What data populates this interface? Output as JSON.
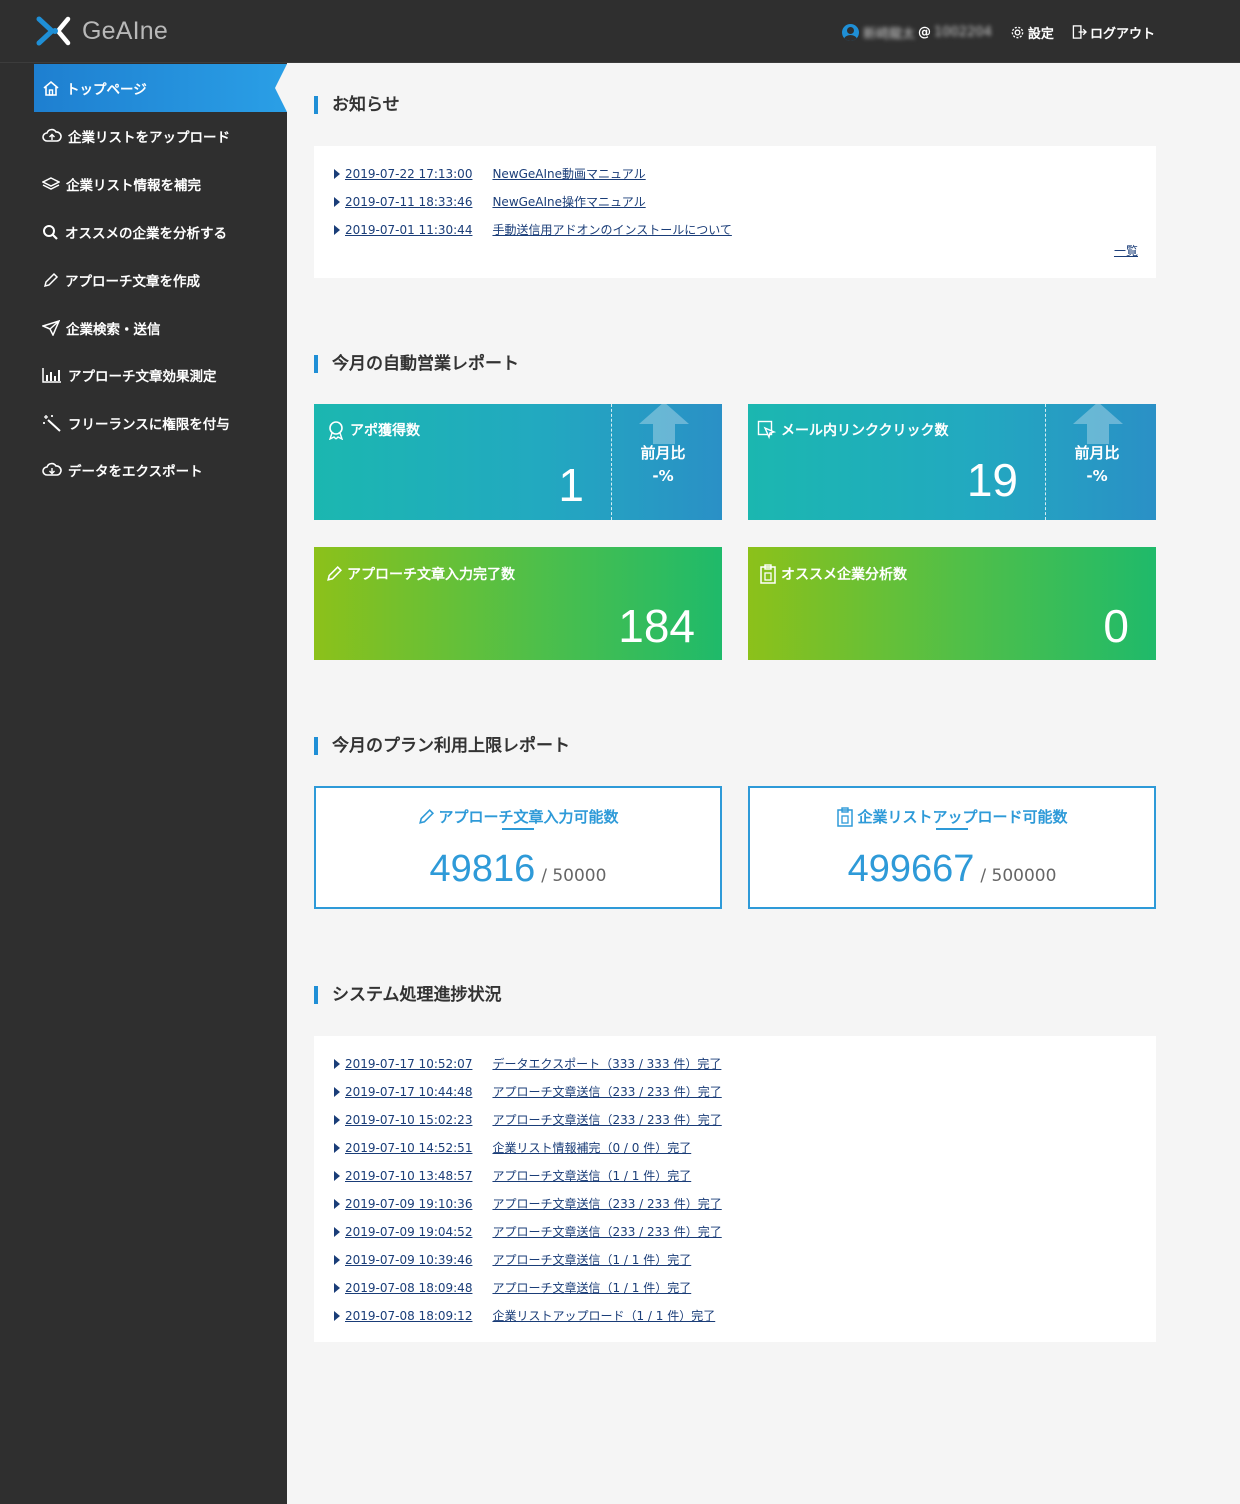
{
  "app": {
    "name": "GeAIne"
  },
  "header": {
    "user_name": "新崎龍太",
    "user_at": "@",
    "user_id": "1002204",
    "settings_label": "設定",
    "logout_label": "ログアウト"
  },
  "sidebar": {
    "items": [
      {
        "label": "トップページ",
        "icon": "home-icon"
      },
      {
        "label": "企業リストをアップロード",
        "icon": "cloud-upload-icon"
      },
      {
        "label": "企業リスト情報を補完",
        "icon": "layers-icon"
      },
      {
        "label": "オススメの企業を分析する",
        "icon": "search-icon"
      },
      {
        "label": "アプローチ文章を作成",
        "icon": "pencil-icon"
      },
      {
        "label": "企業検索・送信",
        "icon": "paper-plane-icon"
      },
      {
        "label": "アプローチ文章効果測定",
        "icon": "bar-chart-icon"
      },
      {
        "label": "フリーランスに権限を付与",
        "icon": "magic-wand-icon"
      },
      {
        "label": "データをエクスポート",
        "icon": "cloud-export-icon"
      }
    ]
  },
  "notices": {
    "title": "お知らせ",
    "items": [
      {
        "datetime": "2019-07-22 17:13:00",
        "text": "NewGeAIne動画マニュアル"
      },
      {
        "datetime": "2019-07-11 18:33:46",
        "text": "NewGeAIne操作マニュアル"
      },
      {
        "datetime": "2019-07-01 11:30:44",
        "text": "手動送信用アドオンのインストールについて"
      }
    ],
    "more_label": "一覧"
  },
  "monthly_report": {
    "title": "今月の自動営業レポート",
    "appointments": {
      "label": "アポ獲得数",
      "value": "1",
      "cmp_label": "前月比",
      "cmp_value": "-%"
    },
    "link_clicks": {
      "label": "メール内リンククリック数",
      "value": "19",
      "cmp_label": "前月比",
      "cmp_value": "-%"
    },
    "approach_done": {
      "label": "アプローチ文章入力完了数",
      "value": "184"
    },
    "recommend_analysis": {
      "label": "オススメ企業分析数",
      "value": "0"
    }
  },
  "plan_limit": {
    "title": "今月のプラン利用上限レポート",
    "approach_input": {
      "label": "アプローチ文章入力可能数",
      "value": "49816",
      "limit": "/ 50000"
    },
    "list_upload": {
      "label": "企業リストアップロード可能数",
      "value": "499667",
      "limit": "/ 500000"
    }
  },
  "system_progress": {
    "title": "システム処理進捗状況",
    "items": [
      {
        "datetime": "2019-07-17 10:52:07",
        "text": "データエクスポート（333 / 333 件）完了"
      },
      {
        "datetime": "2019-07-17 10:44:48",
        "text": "アプローチ文章送信（233 / 233 件）完了"
      },
      {
        "datetime": "2019-07-10 15:02:23",
        "text": "アプローチ文章送信（233 / 233 件）完了"
      },
      {
        "datetime": "2019-07-10 14:52:51",
        "text": "企業リスト情報補完（0 / 0 件）完了"
      },
      {
        "datetime": "2019-07-10 13:48:57",
        "text": "アプローチ文章送信（1 / 1 件）完了"
      },
      {
        "datetime": "2019-07-09 19:10:36",
        "text": "アプローチ文章送信（233 / 233 件）完了"
      },
      {
        "datetime": "2019-07-09 19:04:52",
        "text": "アプローチ文章送信（233 / 233 件）完了"
      },
      {
        "datetime": "2019-07-09 10:39:46",
        "text": "アプローチ文章送信（1 / 1 件）完了"
      },
      {
        "datetime": "2019-07-08 18:09:48",
        "text": "アプローチ文章送信（1 / 1 件）完了"
      },
      {
        "datetime": "2019-07-08 18:09:12",
        "text": "企業リストアップロード（1 / 1 件）完了"
      }
    ]
  },
  "colors": {
    "accent": "#1f8fd6",
    "sidebar_bg": "#2f2f2f",
    "link": "#1a3d78"
  }
}
